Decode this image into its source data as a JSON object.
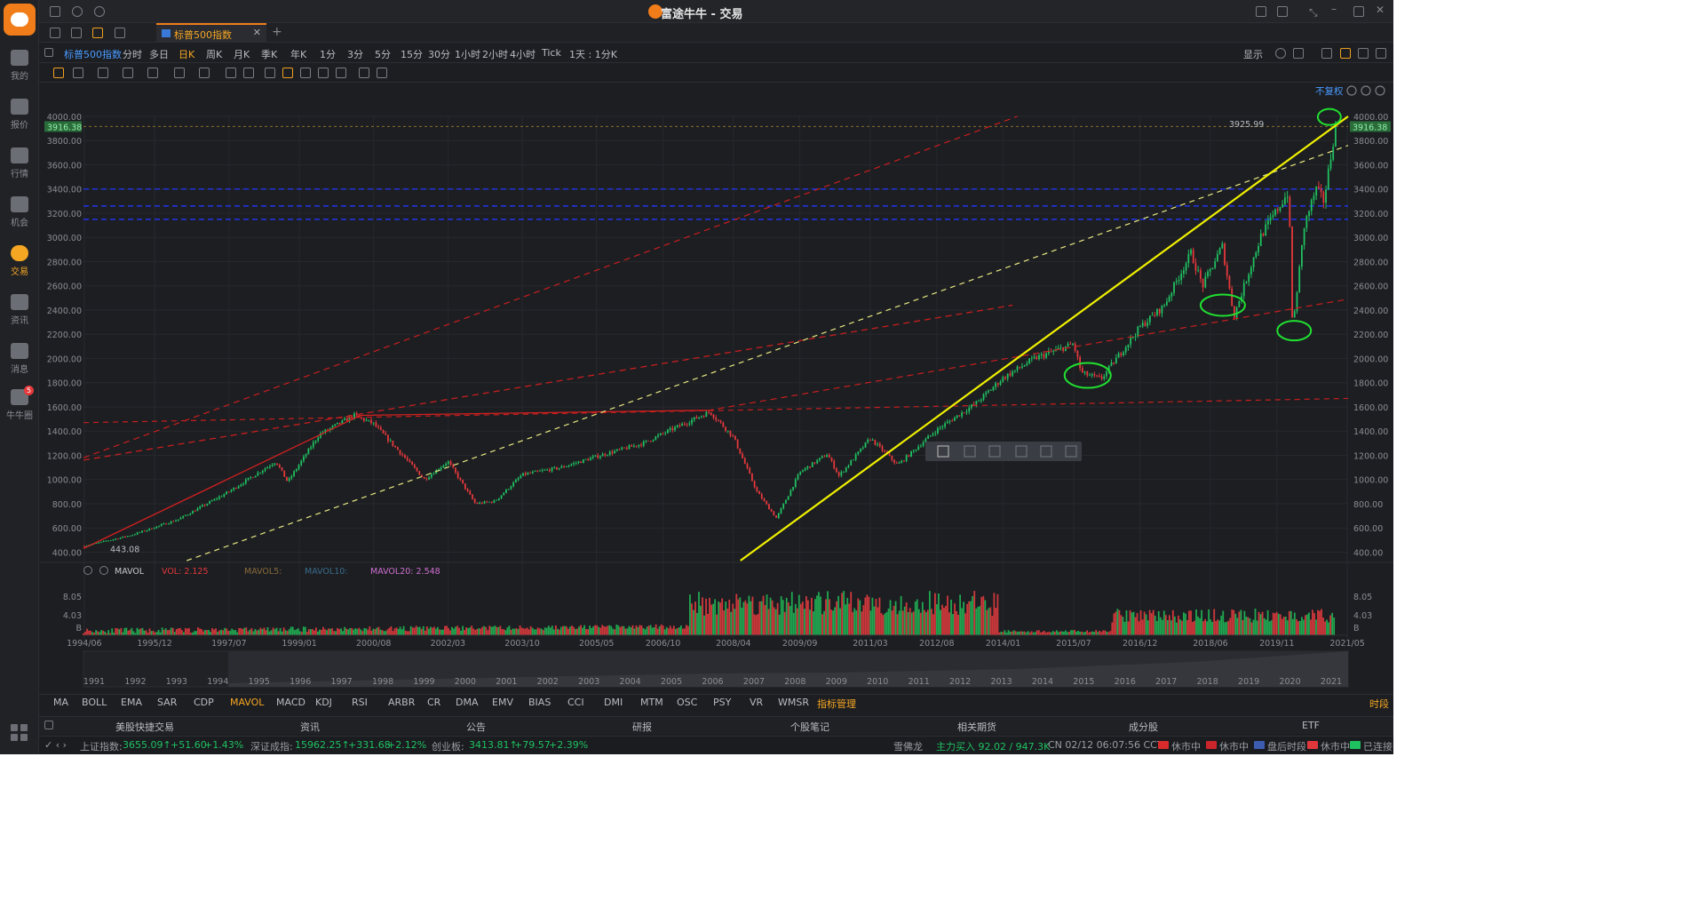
{
  "window": {
    "title": "富途牛牛 - 交易"
  },
  "sidebar": {
    "items": [
      {
        "label": "我的"
      },
      {
        "label": "报价"
      },
      {
        "label": "行情"
      },
      {
        "label": "机会"
      },
      {
        "label": "交易"
      },
      {
        "label": "资讯"
      },
      {
        "label": "消息"
      },
      {
        "label": "牛牛圈",
        "badge": "5"
      }
    ]
  },
  "tabs": {
    "active_label": "标普500指数",
    "plus": "+"
  },
  "toolbar": {
    "stock_name": "标普500指数",
    "periods": [
      "分时",
      "多日",
      "日K",
      "周K",
      "月K",
      "季K",
      "年K",
      "1分",
      "3分",
      "5分",
      "15分",
      "30分",
      "1小时",
      "2小时",
      "4小时",
      "Tick",
      "1天 : 1分K"
    ],
    "active_period": "日K",
    "display_label": "显示"
  },
  "chart_data": {
    "type": "candlestick",
    "fuquan_label": "不复权",
    "y_ticks": [
      "4000.00",
      "3800.00",
      "3600.00",
      "3400.00",
      "3200.00",
      "3000.00",
      "2800.00",
      "2600.00",
      "2400.00",
      "2200.00",
      "2000.00",
      "1800.00",
      "1600.00",
      "1400.00",
      "1200.00",
      "1000.00",
      "800.00",
      "600.00",
      "400.00"
    ],
    "ylim": [
      330,
      4000
    ],
    "price_marker": "3916.38",
    "high_label": "3925.99",
    "low_label": "443.08",
    "close_path": [
      [
        "1994/06",
        450
      ],
      [
        "1995/06",
        540
      ],
      [
        "1996/06",
        670
      ],
      [
        "1997/07",
        900
      ],
      [
        "1998/07",
        1150
      ],
      [
        "1998/10",
        980
      ],
      [
        "1999/06",
        1370
      ],
      [
        "2000/03",
        1530
      ],
      [
        "2000/08",
        1460
      ],
      [
        "2001/04",
        1180
      ],
      [
        "2001/09",
        1000
      ],
      [
        "2002/03",
        1150
      ],
      [
        "2002/10",
        800
      ],
      [
        "2003/03",
        820
      ],
      [
        "2003/10",
        1040
      ],
      [
        "2004/08",
        1100
      ],
      [
        "2005/05",
        1190
      ],
      [
        "2006/05",
        1300
      ],
      [
        "2006/10",
        1380
      ],
      [
        "2007/10",
        1560
      ],
      [
        "2008/04",
        1350
      ],
      [
        "2008/10",
        900
      ],
      [
        "2009/03",
        680
      ],
      [
        "2009/09",
        1060
      ],
      [
        "2010/04",
        1210
      ],
      [
        "2010/07",
        1030
      ],
      [
        "2011/03",
        1340
      ],
      [
        "2011/10",
        1120
      ],
      [
        "2012/08",
        1410
      ],
      [
        "2013/06",
        1630
      ],
      [
        "2014/01",
        1840
      ],
      [
        "2014/09",
        2000
      ],
      [
        "2015/07",
        2120
      ],
      [
        "2015/09",
        1880
      ],
      [
        "2016/02",
        1830
      ],
      [
        "2016/12",
        2260
      ],
      [
        "2017/06",
        2430
      ],
      [
        "2018/01",
        2870
      ],
      [
        "2018/04",
        2600
      ],
      [
        "2018/09",
        2930
      ],
      [
        "2018/12",
        2350
      ],
      [
        "2019/07",
        3020
      ],
      [
        "2020/02",
        3380
      ],
      [
        "2020/03",
        2230
      ],
      [
        "2020/06",
        3100
      ],
      [
        "2020/09",
        3400
      ],
      [
        "2020/11",
        3300
      ],
      [
        "2021/02",
        3926
      ]
    ],
    "volume_panel": {
      "name": "MAVOL",
      "vol": "VOL: 2.125",
      "mavol5": "MAVOL5:",
      "mavol10": "MAVOL10:",
      "mavol20": "MAVOL20: 2.548",
      "y_ticks": [
        "8.05",
        "4.03",
        "B"
      ]
    },
    "x_labels": [
      "1994/06",
      "1995/12",
      "1997/07",
      "1999/01",
      "2000/08",
      "2002/03",
      "2003/10",
      "2005/05",
      "2006/10",
      "2008/04",
      "2009/09",
      "2011/03",
      "2012/08",
      "2014/01",
      "2015/07",
      "2016/12",
      "2018/06",
      "2019/11",
      "2021/05"
    ],
    "navigator_years": [
      "1991",
      "1992",
      "1993",
      "1994",
      "1995",
      "1996",
      "1997",
      "1998",
      "1999",
      "2000",
      "2001",
      "2002",
      "2003",
      "2004",
      "2005",
      "2006",
      "2007",
      "2008",
      "2009",
      "2010",
      "2011",
      "2012",
      "2013",
      "2014",
      "2015",
      "2016",
      "2017",
      "2018",
      "2019",
      "2020",
      "2021"
    ]
  },
  "indicators": {
    "items": [
      "MA",
      "BOLL",
      "EMA",
      "SAR",
      "CDP",
      "MAVOL",
      "MACD",
      "KDJ",
      "RSI",
      "ARBR",
      "CR",
      "DMA",
      "EMV",
      "BIAS",
      "CCI",
      "DMI",
      "MTM",
      "OSC",
      "PSY",
      "VR",
      "WMSR",
      "指标管理"
    ],
    "active": "MAVOL",
    "right_label": "时段"
  },
  "bottom_tabs": [
    "美股快捷交易",
    "资讯",
    "公告",
    "研报",
    "个股笔记",
    "相关期货",
    "成分股",
    "ETF"
  ],
  "status": {
    "sh_label": "上证指数:",
    "sh_value": "3655.09↑",
    "sh_change": "+51.60",
    "sh_pct": "+1.43%",
    "sz_label": "深证成指:",
    "sz_value": "15962.25↑",
    "sz_change": "+331.68",
    "sz_pct": "+2.12%",
    "cy_label": "创业板:",
    "cy_value": "3413.81↑",
    "cy_change": "+79.57",
    "cy_pct": "+2.39%",
    "stock": "雪佛龙",
    "flow": "主力买入 92.02 / 947.3K",
    "clock": "CN 02/12 06:07:56 CCT",
    "cn_state": "休市中",
    "hk_state": "休市中",
    "us_state": "盘后时段",
    "sg_state": "休市中",
    "conn": "已连接",
    "colors": {
      "up": "#20c060",
      "down": "#e5383b"
    }
  }
}
